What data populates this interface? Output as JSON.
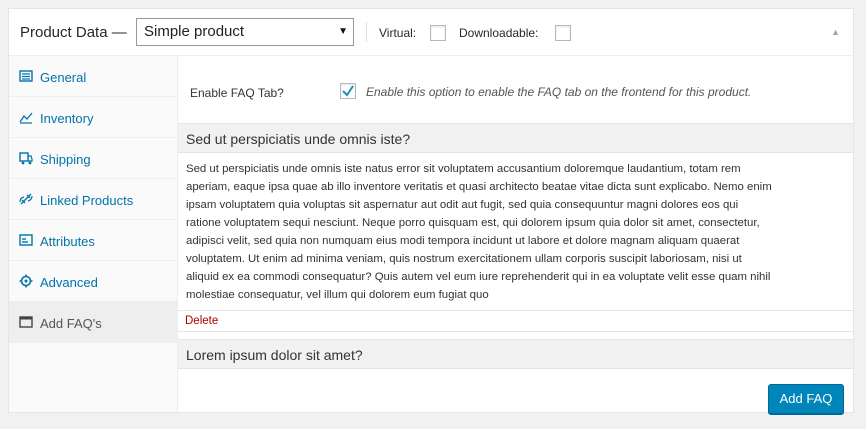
{
  "header": {
    "title": "Product Data —",
    "product_type": "Simple product",
    "virtual_label": "Virtual:",
    "downloadable_label": "Downloadable:",
    "toggle_icon": "triangle-up-icon"
  },
  "tabs": [
    {
      "label": "General",
      "icon": "general-icon"
    },
    {
      "label": "Inventory",
      "icon": "inventory-icon"
    },
    {
      "label": "Shipping",
      "icon": "shipping-icon"
    },
    {
      "label": "Linked Products",
      "icon": "link-icon"
    },
    {
      "label": "Attributes",
      "icon": "attributes-icon"
    },
    {
      "label": "Advanced",
      "icon": "gear-icon"
    },
    {
      "label": "Add FAQ's",
      "icon": "window-icon",
      "active": true
    }
  ],
  "faq": {
    "enable_label": "Enable FAQ Tab?",
    "enable_checked": true,
    "enable_desc": "Enable this option to enable the FAQ tab on the frontend for this product.",
    "items": [
      {
        "question": "Sed ut perspiciatis unde omnis iste?",
        "answer_lines": [
          "Sed ut perspiciatis unde omnis iste natus error sit voluptatem accusantium doloremque laudantium, totam rem",
          "aperiam, eaque ipsa quae ab illo inventore veritatis et quasi architecto beatae vitae dicta sunt explicabo. Nemo enim",
          "ipsam voluptatem quia voluptas sit aspernatur aut odit aut fugit, sed quia consequuntur magni dolores eos qui",
          "ratione voluptatem sequi nesciunt. Neque porro quisquam est, qui dolorem ipsum quia dolor sit amet, consectetur,",
          "adipisci velit, sed quia non numquam eius modi tempora incidunt ut labore et dolore magnam aliquam quaerat",
          "voluptatem. Ut enim ad minima veniam, quis nostrum exercitationem ullam corporis suscipit laboriosam, nisi ut",
          "aliquid ex ea commodi consequatur? Quis autem vel eum iure reprehenderit qui in ea voluptate velit esse quam nihil",
          "molestiae consequatur, vel illum qui dolorem eum fugiat quo"
        ],
        "delete_label": "Delete"
      },
      {
        "question": "Lorem ipsum dolor sit amet?"
      }
    ],
    "add_button": "Add FAQ"
  },
  "colors": {
    "link": "#0073aa",
    "primary_button": "#0085ba",
    "delete": "#aa0000",
    "check": "#1e8cbe"
  }
}
